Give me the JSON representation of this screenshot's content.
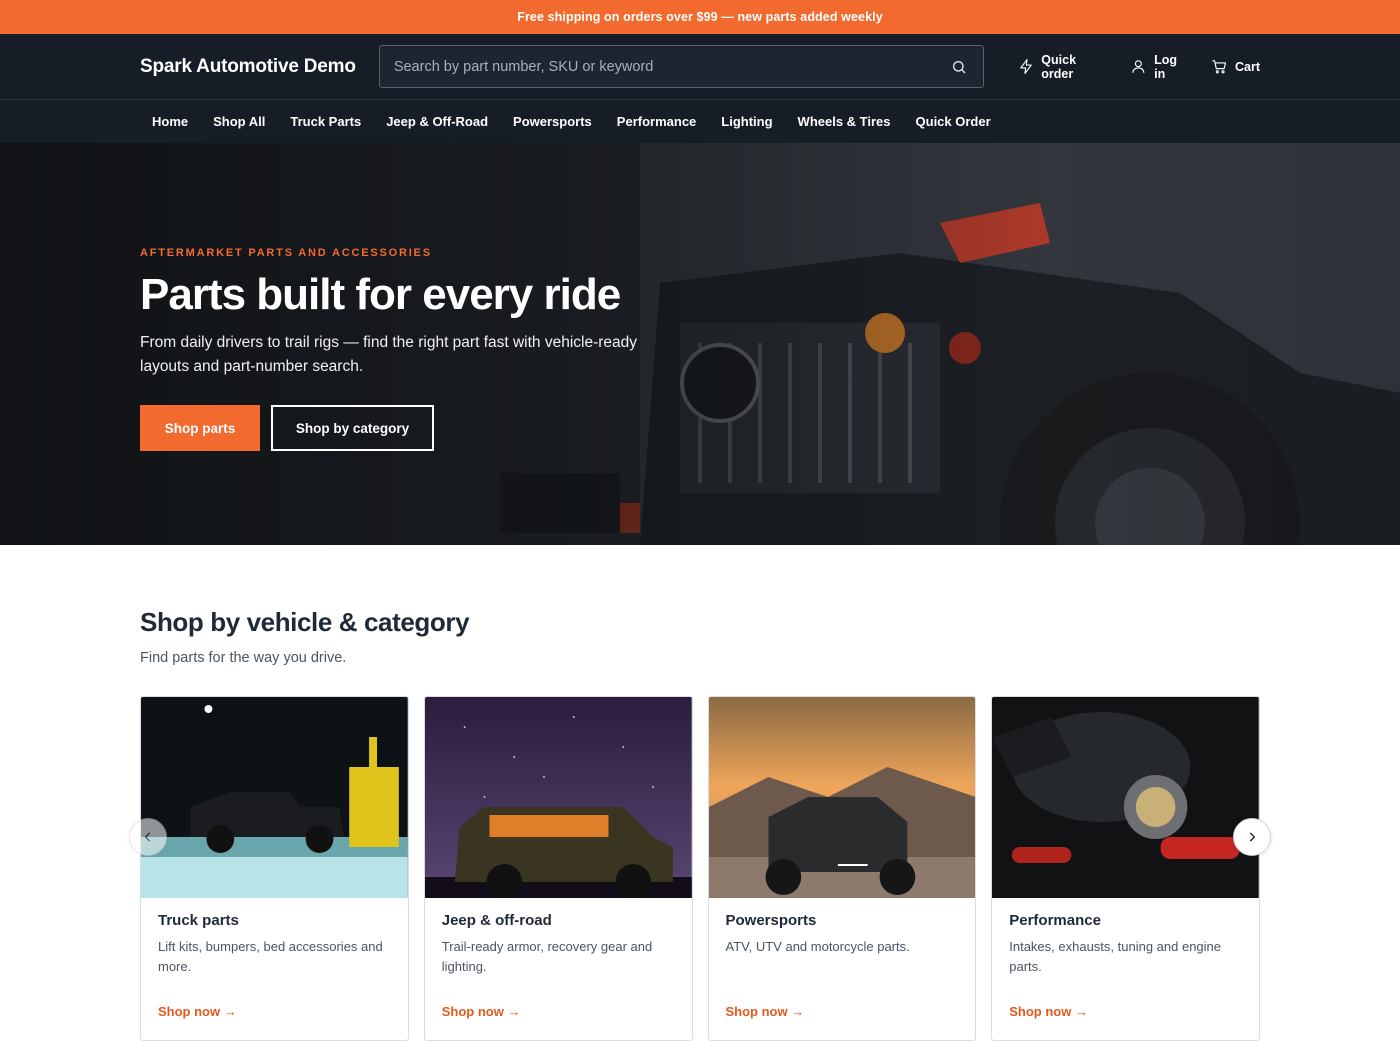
{
  "announcement": "Free shipping on orders over $99 — new parts added weekly",
  "header": {
    "logo": "Spark Automotive Demo",
    "search_placeholder": "Search by part number, SKU or keyword",
    "quick_order": "Quick order",
    "login": "Log in",
    "cart": "Cart"
  },
  "nav": [
    "Home",
    "Shop All",
    "Truck Parts",
    "Jeep & Off-Road",
    "Powersports",
    "Performance",
    "Lighting",
    "Wheels & Tires",
    "Quick Order"
  ],
  "hero": {
    "eyebrow": "AFTERMARKET PARTS AND ACCESSORIES",
    "title": "Parts built for every ride",
    "text": "From daily drivers to trail rigs — find the right part fast with vehicle-ready layouts and part-number search.",
    "btn_primary": "Shop parts",
    "btn_secondary": "Shop by category"
  },
  "categories_section": {
    "title": "Shop by vehicle & category",
    "subtitle": "Find parts for the way you drive.",
    "cards": [
      {
        "title": "Truck parts",
        "desc": "Lift kits, bumpers, bed accessories and more.",
        "link": "Shop now →"
      },
      {
        "title": "Jeep & off-road",
        "desc": "Trail-ready armor, recovery gear and lighting.",
        "link": "Shop now →"
      },
      {
        "title": "Powersports",
        "desc": "ATV, UTV and motorcycle parts.",
        "link": "Shop now →"
      },
      {
        "title": "Performance",
        "desc": "Intakes, exhausts, tuning and engine parts.",
        "link": "Shop now →"
      }
    ]
  },
  "icons": {
    "search": "search-icon",
    "quick_order": "lightning-icon",
    "login": "user-icon",
    "cart": "cart-icon",
    "prev": "chevron-left-icon",
    "next": "chevron-right-icon"
  },
  "colors": {
    "accent": "#f26a2e",
    "header_bg": "#171d26"
  }
}
